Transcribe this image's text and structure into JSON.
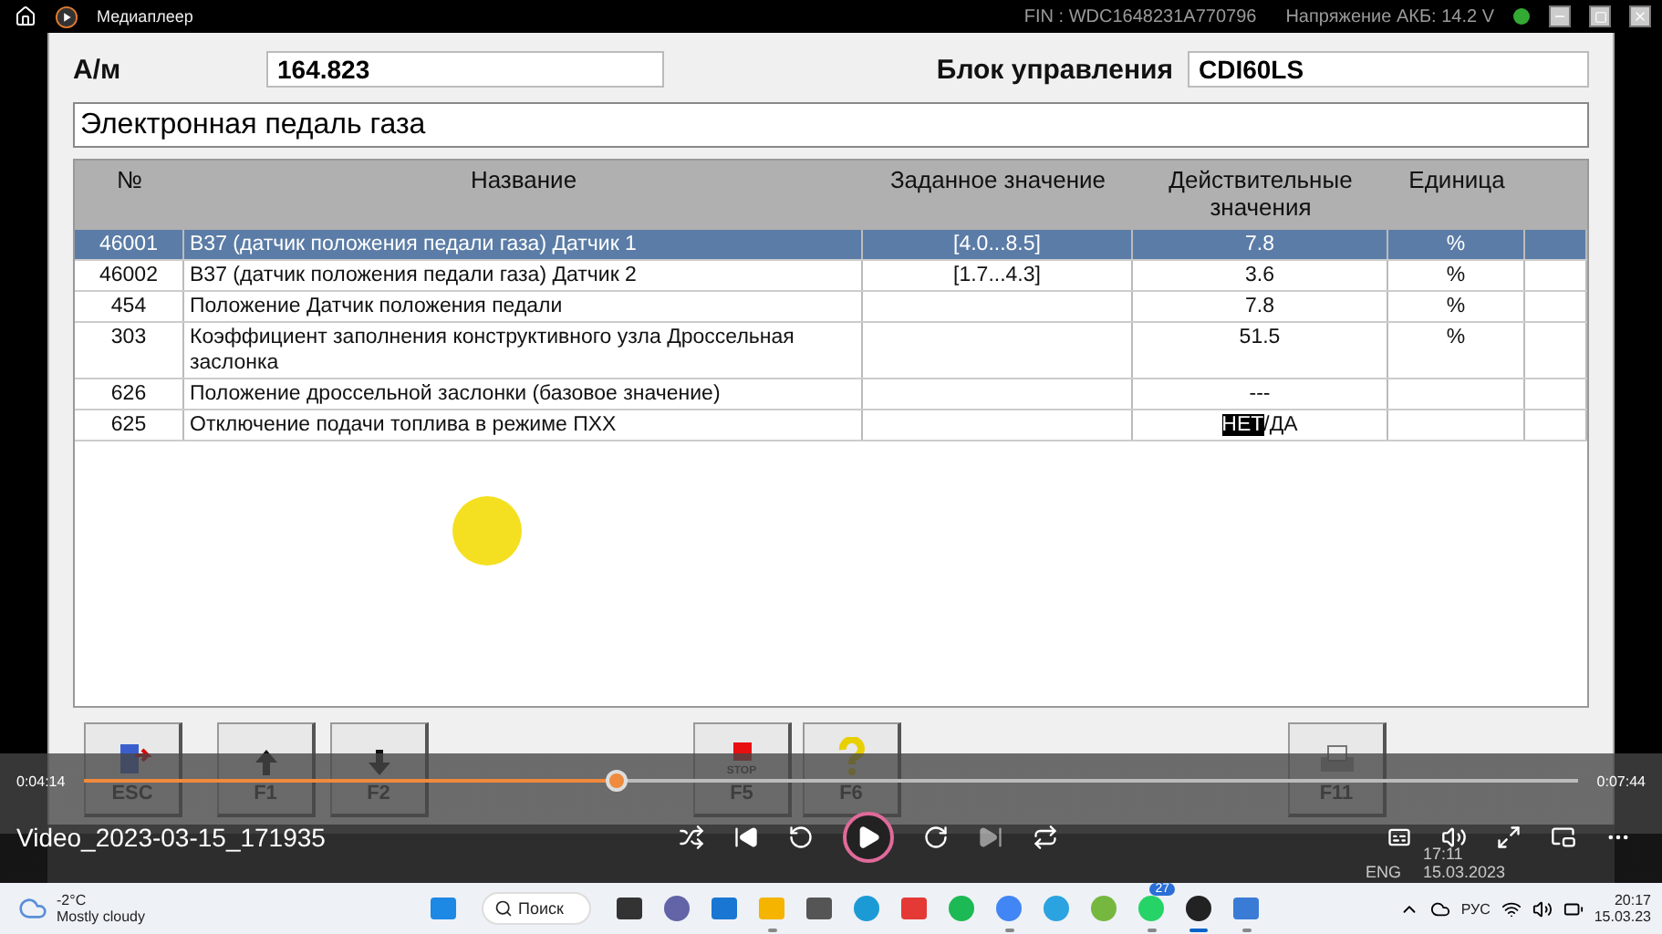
{
  "player": {
    "title": "Медиаплеер"
  },
  "video": {
    "status": {
      "fin": "FIN : WDC1648231A770796",
      "battery": "Напряжение АКБ: 14.2 V"
    },
    "vehicle": {
      "label": "А/м",
      "value": "164.823"
    },
    "control_unit": {
      "label": "Блок управления",
      "value": "CDI60LS"
    },
    "section_title": "Электронная педаль газа",
    "table": {
      "columns": [
        "№",
        "Название",
        "Заданное значение",
        "Действительные значения",
        "Единица"
      ],
      "rows": [
        {
          "no": "46001",
          "name": "B37 (датчик положения педали газа) Датчик 1",
          "target": "[4.0...8.5]",
          "actual": "7.8",
          "unit": "%",
          "selected": true
        },
        {
          "no": "46002",
          "name": "B37 (датчик положения педали газа) Датчик 2",
          "target": "[1.7...4.3]",
          "actual": "3.6",
          "unit": "%",
          "selected": false
        },
        {
          "no": "454",
          "name": "Положение Датчик положения педали",
          "actual": "7.8",
          "unit": "%",
          "selected": false
        },
        {
          "no": "303",
          "name": "Коэффициент заполнения конструктивного узла Дроссельная заслонка",
          "actual": "51.5",
          "unit": "%",
          "selected": false
        },
        {
          "no": "626",
          "name": "Положение дроссельной заслонки (базовое значение)",
          "actual": "---",
          "selected": false
        },
        {
          "no": "625",
          "name": "Отключение подачи топлива в режиме ПХХ",
          "actual_options": [
            {
              "label": "НЕТ",
              "selected": true
            },
            {
              "label": "ДА",
              "selected": false
            }
          ],
          "separator": "/",
          "selected": false
        }
      ]
    },
    "function_keys": [
      {
        "label": "ESC",
        "kind": "exit"
      },
      {
        "label": "F1",
        "kind": "up"
      },
      {
        "label": "F2",
        "kind": "down"
      },
      {
        "label": "F5",
        "kind": "stop",
        "caption": "STOP"
      },
      {
        "label": "F6",
        "kind": "help"
      },
      {
        "label": "F11",
        "kind": "print"
      }
    ],
    "recorded_taskbar": {
      "language": "ENG",
      "time": "17:11",
      "date": "15.03.2023"
    }
  },
  "playback": {
    "elapsed": "0:04:14",
    "total": "0:07:44",
    "level": 0.357,
    "file_name": "Video_2023-03-15_171935",
    "playing": false
  },
  "taskbar": {
    "weather": {
      "temperature": "-2°C",
      "condition": "Mostly cloudy"
    },
    "search": {
      "placeholder": "Поиск"
    },
    "apps": [
      {
        "kind": "start",
        "running": false,
        "active": false
      },
      {
        "kind": "taskview",
        "running": false,
        "active": false
      },
      {
        "kind": "teams",
        "running": false,
        "active": false
      },
      {
        "kind": "mail",
        "running": false,
        "active": false
      },
      {
        "kind": "folder",
        "running": true,
        "active": false
      },
      {
        "kind": "calculator",
        "running": false,
        "active": false
      },
      {
        "kind": "edge",
        "running": false,
        "active": false
      },
      {
        "kind": "remote",
        "running": false,
        "active": false
      },
      {
        "kind": "music",
        "running": false,
        "active": false
      },
      {
        "kind": "chrome",
        "running": true,
        "active": false
      },
      {
        "kind": "telegram",
        "running": false,
        "active": false
      },
      {
        "kind": "torrent",
        "running": false,
        "active": false
      },
      {
        "kind": "chat",
        "running": true,
        "active": false,
        "badge": "27"
      },
      {
        "kind": "player",
        "running": true,
        "active": true
      },
      {
        "kind": "cloud",
        "running": true,
        "active": false
      }
    ],
    "language": "РУС",
    "time": "20:17",
    "date": "15.03.23"
  }
}
